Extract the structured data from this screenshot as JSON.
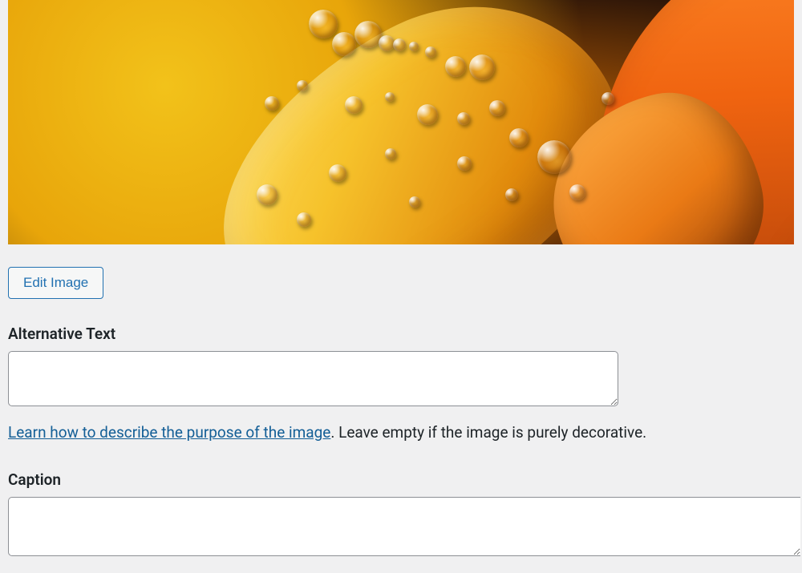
{
  "buttons": {
    "edit_image": "Edit Image"
  },
  "fields": {
    "alt_label": "Alternative Text",
    "alt_value": "",
    "caption_label": "Caption",
    "caption_value": ""
  },
  "help": {
    "link_text": "Learn how to describe the purpose of the image",
    "trailing_text": ". Leave empty if the image is purely decorative."
  }
}
